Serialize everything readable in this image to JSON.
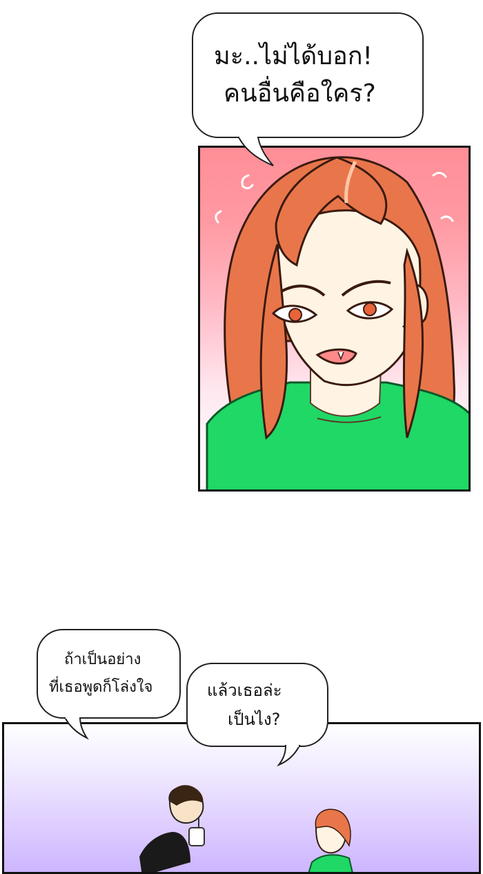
{
  "bubbles": {
    "top": {
      "line1": "มะ..ไม่ได้บอก!",
      "line2": "คนอื่นคือใคร?"
    },
    "left": {
      "line1": "ถ้าเป็นอย่าง",
      "line2": "ที่เธอพูดก็โล่งใจ"
    },
    "right": {
      "line1": "แล้วเธอล่ะ",
      "line2": "เป็นไง?"
    }
  },
  "colors": {
    "panel1_bg_top": "#ff8e97",
    "hair": "#e8764a",
    "shirt": "#1fd865",
    "skin": "#fff4e3",
    "panel2_bg": "#cdb6ff"
  }
}
